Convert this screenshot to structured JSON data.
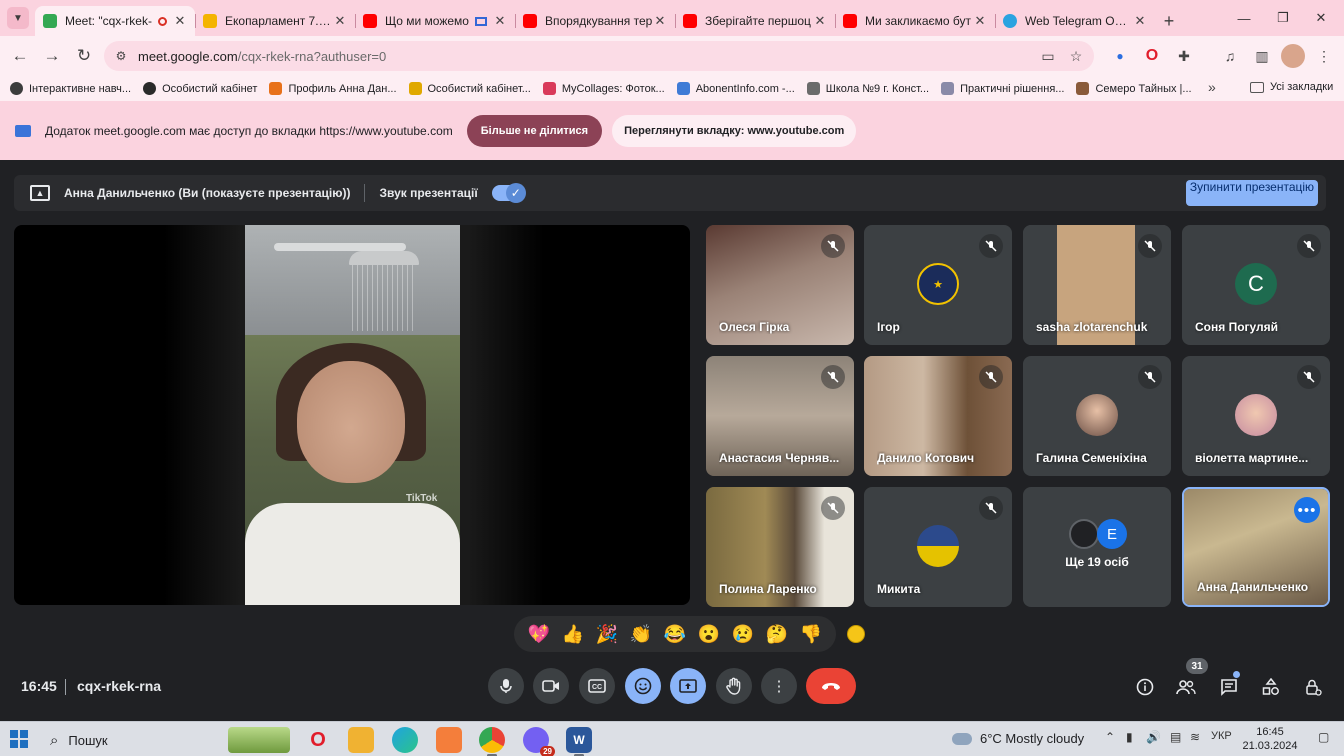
{
  "browser": {
    "tabs": [
      {
        "title": "Meet: \"cqx-rkek-",
        "favicon_color": "#34a853",
        "active": true
      },
      {
        "title": "Екопарламент 7.ppt",
        "favicon_color": "#f4b400"
      },
      {
        "title": "Що ми можемо",
        "favicon_color": "#ff0000"
      },
      {
        "title": "Впорядкування тер",
        "favicon_color": "#ff0000"
      },
      {
        "title": "Зберігайте першоц",
        "favicon_color": "#ff0000"
      },
      {
        "title": "Ми закликаємо бут",
        "favicon_color": "#ff0000"
      },
      {
        "title": "Web Telegram Online",
        "favicon_color": "#2aa3e0"
      }
    ],
    "url_host": "meet.google.com",
    "url_path": "/cqx-rkek-rna?authuser=0",
    "bookmarks": [
      {
        "label": "Інтерактивне навч...",
        "color": "#3c3c3c"
      },
      {
        "label": "Особистий кабінет",
        "color": "#2a2a2a"
      },
      {
        "label": "Профиль Анна Дан...",
        "color": "#e8711a"
      },
      {
        "label": "Особистий кабінет...",
        "color": "#e0a800"
      },
      {
        "label": "MyCollages: Фоток...",
        "color": "#d93a5a"
      },
      {
        "label": "AbonentInfo.com -...",
        "color": "#3f7bd6"
      },
      {
        "label": "Школа №9 г. Конст...",
        "color": "#6b6b6b"
      },
      {
        "label": "Практичні рішення...",
        "color": "#8a8aa8"
      },
      {
        "label": "Семеро Тайных |...",
        "color": "#8a5a3a"
      }
    ],
    "all_bookmarks_label": "Усі закладки"
  },
  "infobar": {
    "message": "Додаток meet.google.com має доступ до вкладки https://www.youtube.com",
    "stop_sharing_label": "Більше не ділитися",
    "view_tab_label": "Переглянути вкладку: www.youtube.com"
  },
  "presentation_bar": {
    "presenter_text": "Анна Данильченко (Ви (показуєте презентацію))",
    "audio_label": "Звук презентації",
    "audio_on": true,
    "stop_button_label": "Зупинити презентацію"
  },
  "stage": {
    "watermark": "TikTok"
  },
  "participants": [
    {
      "name": "Олеся Гірка",
      "muted": true
    },
    {
      "name": "Ігор",
      "muted": true
    },
    {
      "name": "sasha zlotarenchuk",
      "muted": true
    },
    {
      "name": "Соня Погуляй",
      "muted": true,
      "initial": "C",
      "avatar_color": "#1e6b4f"
    },
    {
      "name": "Анастасия Черняв...",
      "muted": true
    },
    {
      "name": "Данило Котович",
      "muted": true
    },
    {
      "name": "Галина Семеніхіна",
      "muted": true
    },
    {
      "name": "віолетта мартине...",
      "muted": true
    },
    {
      "name": "Полина Ларенко",
      "muted": true
    },
    {
      "name": "Микита",
      "muted": true
    },
    {
      "name": "Анна Данильченко",
      "muted": false
    }
  ],
  "more_tile": {
    "label": "Ще 19 осіб",
    "initial": "E"
  },
  "reactions": [
    "💖",
    "👍",
    "🎉",
    "👏",
    "😂",
    "😮",
    "😢",
    "🤔",
    "👎"
  ],
  "controls": {
    "time": "16:45",
    "meeting_code": "cqx-rkek-rna",
    "people_count": "31"
  },
  "taskbar": {
    "search_label": "Пошук",
    "weather": "6°C  Mostly cloudy",
    "language": "УКР",
    "time": "16:45",
    "date": "21.03.2024",
    "viber_badge": "29"
  }
}
